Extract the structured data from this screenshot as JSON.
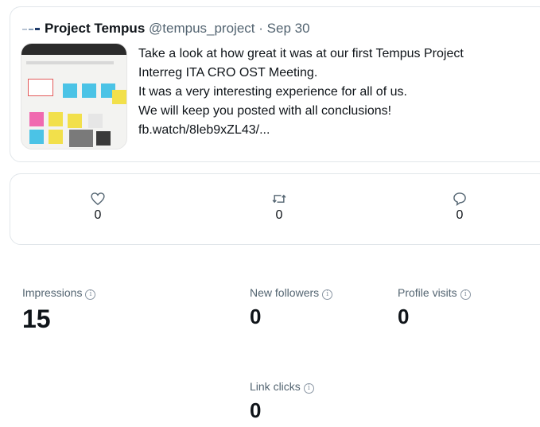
{
  "tweet": {
    "author": "Project Tempus",
    "handle": "@tempus_project",
    "separator": "·",
    "date": "Sep 30",
    "lines": [
      "Take a look at how great it was at our first Tempus Project",
      "Interreg ITA CRO OST Meeting.",
      "It was a very interesting experience for all of us.",
      "We will keep you posted with all conclusions!",
      "fb.watch/8leb9xZL43/..."
    ]
  },
  "actions": {
    "likes": "0",
    "retweets": "0",
    "replies": "0"
  },
  "stats": {
    "impressions": {
      "label": "Impressions",
      "value": "15"
    },
    "new_followers": {
      "label": "New followers",
      "value": "0"
    },
    "profile_visits": {
      "label": "Profile visits",
      "value": "0"
    },
    "link_clicks": {
      "label": "Link clicks",
      "value": "0"
    }
  },
  "info_glyph": "i",
  "icons": {
    "like": "heart-icon",
    "retweet": "retweet-icon",
    "reply": "reply-icon",
    "info": "info-icon",
    "logo": "project-tempus-logo-icon"
  },
  "colors": {
    "text": "#0f1419",
    "muted": "#536471",
    "border": "#e1e6ea"
  }
}
